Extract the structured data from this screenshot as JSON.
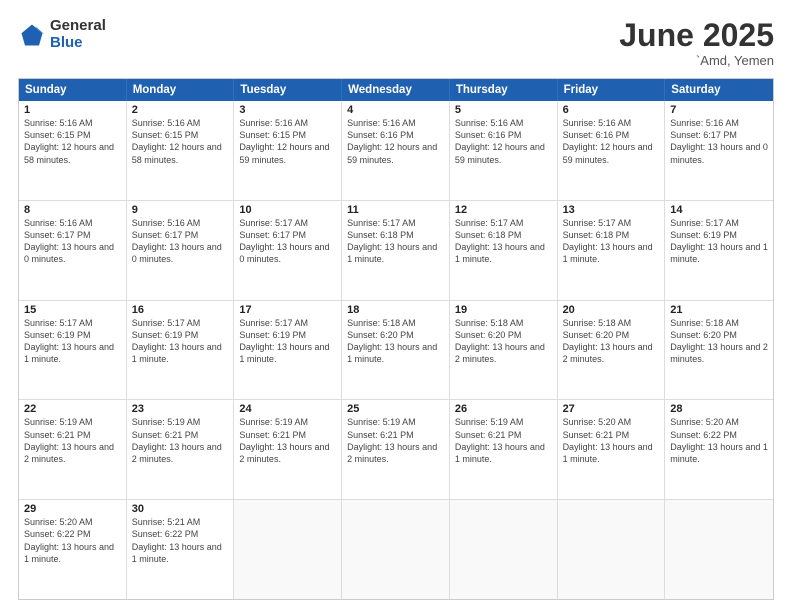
{
  "logo": {
    "general": "General",
    "blue": "Blue"
  },
  "title": "June 2025",
  "location": "`Amd, Yemen",
  "days": [
    "Sunday",
    "Monday",
    "Tuesday",
    "Wednesday",
    "Thursday",
    "Friday",
    "Saturday"
  ],
  "rows": [
    [
      {
        "day": "",
        "empty": true
      },
      {
        "day": "2",
        "sunrise": "5:16 AM",
        "sunset": "6:15 PM",
        "daylight": "12 hours and 58 minutes."
      },
      {
        "day": "3",
        "sunrise": "5:16 AM",
        "sunset": "6:15 PM",
        "daylight": "12 hours and 59 minutes."
      },
      {
        "day": "4",
        "sunrise": "5:16 AM",
        "sunset": "6:16 PM",
        "daylight": "12 hours and 59 minutes."
      },
      {
        "day": "5",
        "sunrise": "5:16 AM",
        "sunset": "6:16 PM",
        "daylight": "12 hours and 59 minutes."
      },
      {
        "day": "6",
        "sunrise": "5:16 AM",
        "sunset": "6:16 PM",
        "daylight": "12 hours and 59 minutes."
      },
      {
        "day": "7",
        "sunrise": "5:16 AM",
        "sunset": "6:17 PM",
        "daylight": "13 hours and 0 minutes."
      }
    ],
    [
      {
        "day": "8",
        "sunrise": "5:16 AM",
        "sunset": "6:17 PM",
        "daylight": "13 hours and 0 minutes."
      },
      {
        "day": "9",
        "sunrise": "5:16 AM",
        "sunset": "6:17 PM",
        "daylight": "13 hours and 0 minutes."
      },
      {
        "day": "10",
        "sunrise": "5:17 AM",
        "sunset": "6:17 PM",
        "daylight": "13 hours and 0 minutes."
      },
      {
        "day": "11",
        "sunrise": "5:17 AM",
        "sunset": "6:18 PM",
        "daylight": "13 hours and 1 minute."
      },
      {
        "day": "12",
        "sunrise": "5:17 AM",
        "sunset": "6:18 PM",
        "daylight": "13 hours and 1 minute."
      },
      {
        "day": "13",
        "sunrise": "5:17 AM",
        "sunset": "6:18 PM",
        "daylight": "13 hours and 1 minute."
      },
      {
        "day": "14",
        "sunrise": "5:17 AM",
        "sunset": "6:19 PM",
        "daylight": "13 hours and 1 minute."
      }
    ],
    [
      {
        "day": "15",
        "sunrise": "5:17 AM",
        "sunset": "6:19 PM",
        "daylight": "13 hours and 1 minute."
      },
      {
        "day": "16",
        "sunrise": "5:17 AM",
        "sunset": "6:19 PM",
        "daylight": "13 hours and 1 minute."
      },
      {
        "day": "17",
        "sunrise": "5:17 AM",
        "sunset": "6:19 PM",
        "daylight": "13 hours and 1 minute."
      },
      {
        "day": "18",
        "sunrise": "5:18 AM",
        "sunset": "6:20 PM",
        "daylight": "13 hours and 1 minute."
      },
      {
        "day": "19",
        "sunrise": "5:18 AM",
        "sunset": "6:20 PM",
        "daylight": "13 hours and 2 minutes."
      },
      {
        "day": "20",
        "sunrise": "5:18 AM",
        "sunset": "6:20 PM",
        "daylight": "13 hours and 2 minutes."
      },
      {
        "day": "21",
        "sunrise": "5:18 AM",
        "sunset": "6:20 PM",
        "daylight": "13 hours and 2 minutes."
      }
    ],
    [
      {
        "day": "22",
        "sunrise": "5:19 AM",
        "sunset": "6:21 PM",
        "daylight": "13 hours and 2 minutes."
      },
      {
        "day": "23",
        "sunrise": "5:19 AM",
        "sunset": "6:21 PM",
        "daylight": "13 hours and 2 minutes."
      },
      {
        "day": "24",
        "sunrise": "5:19 AM",
        "sunset": "6:21 PM",
        "daylight": "13 hours and 2 minutes."
      },
      {
        "day": "25",
        "sunrise": "5:19 AM",
        "sunset": "6:21 PM",
        "daylight": "13 hours and 2 minutes."
      },
      {
        "day": "26",
        "sunrise": "5:19 AM",
        "sunset": "6:21 PM",
        "daylight": "13 hours and 1 minute."
      },
      {
        "day": "27",
        "sunrise": "5:20 AM",
        "sunset": "6:21 PM",
        "daylight": "13 hours and 1 minute."
      },
      {
        "day": "28",
        "sunrise": "5:20 AM",
        "sunset": "6:22 PM",
        "daylight": "13 hours and 1 minute."
      }
    ],
    [
      {
        "day": "29",
        "sunrise": "5:20 AM",
        "sunset": "6:22 PM",
        "daylight": "13 hours and 1 minute."
      },
      {
        "day": "30",
        "sunrise": "5:21 AM",
        "sunset": "6:22 PM",
        "daylight": "13 hours and 1 minute."
      },
      {
        "day": "",
        "empty": true
      },
      {
        "day": "",
        "empty": true
      },
      {
        "day": "",
        "empty": true
      },
      {
        "day": "",
        "empty": true
      },
      {
        "day": "",
        "empty": true
      }
    ]
  ],
  "row0": [
    {
      "day": "1",
      "sunrise": "5:16 AM",
      "sunset": "6:15 PM",
      "daylight": "12 hours and 58 minutes."
    }
  ]
}
